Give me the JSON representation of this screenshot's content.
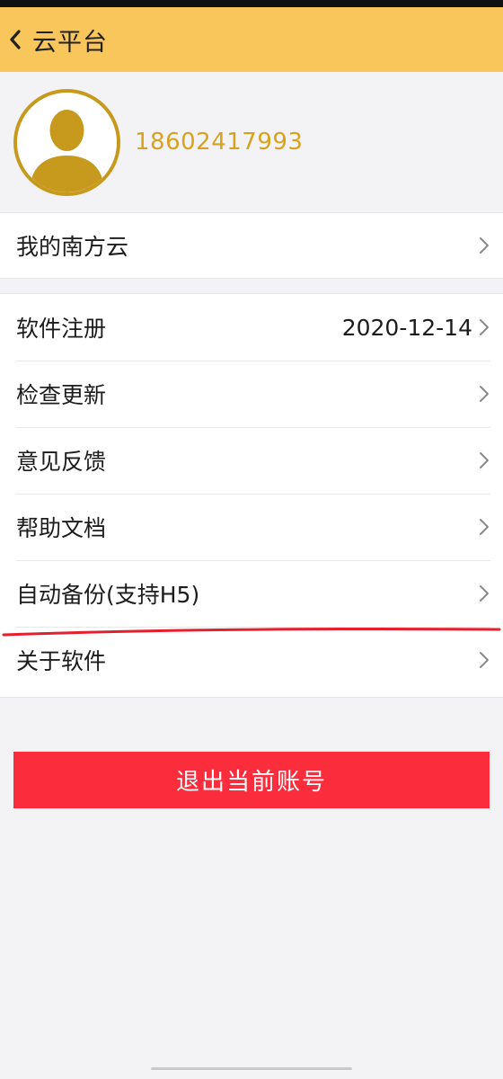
{
  "header": {
    "title": "云平台",
    "back_icon": "chevron-left-icon"
  },
  "profile": {
    "avatar_icon": "user-avatar-icon",
    "phone": "18602417993"
  },
  "group1": {
    "items": [
      {
        "label": "我的南方云",
        "value": ""
      }
    ]
  },
  "group2": {
    "items": [
      {
        "label": "软件注册",
        "value": "2020-12-14"
      },
      {
        "label": "检查更新",
        "value": ""
      },
      {
        "label": "意见反馈",
        "value": ""
      },
      {
        "label": "帮助文档",
        "value": ""
      },
      {
        "label": "自动备份(支持H5)",
        "value": ""
      },
      {
        "label": "关于软件",
        "value": ""
      }
    ]
  },
  "logout": {
    "label": "退出当前账号"
  },
  "colors": {
    "header_bg": "#f8c65a",
    "accent_gold": "#d9a21e",
    "logout_bg": "#fb2d3d",
    "annotation_red": "#e5202e"
  }
}
